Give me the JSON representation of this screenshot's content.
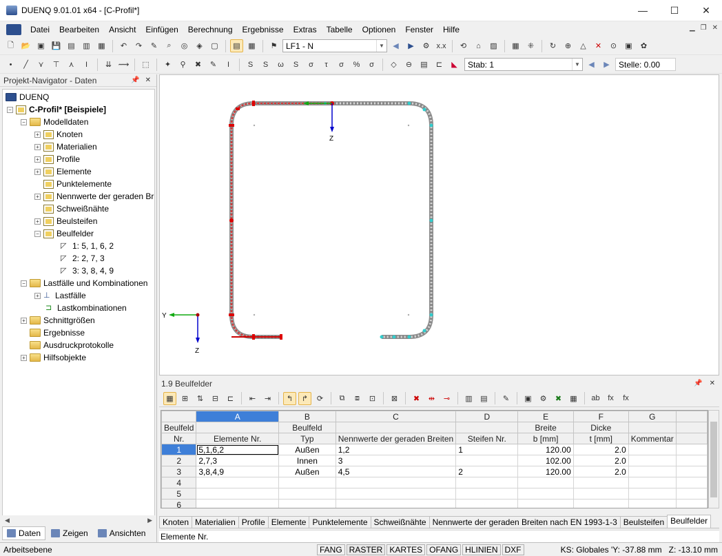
{
  "window": {
    "title": "DUENQ 9.01.01 x64 - [C-Profil*]",
    "min": "—",
    "max": "☐",
    "close": "✕"
  },
  "menu": [
    "Datei",
    "Bearbeiten",
    "Ansicht",
    "Einfügen",
    "Berechnung",
    "Ergebnisse",
    "Extras",
    "Tabelle",
    "Optionen",
    "Fenster",
    "Hilfe"
  ],
  "toolbar": {
    "loadcase": "LF1 - N",
    "stab_label": "Stab: 1",
    "stelle_label": "Stelle: 0.00"
  },
  "navigator": {
    "title": "Projekt-Navigator - Daten",
    "root": "DUENQ",
    "project": "C-Profil* [Beispiele]",
    "items": [
      "Modelldaten",
      "Knoten",
      "Materialien",
      "Profile",
      "Elemente",
      "Punktelemente",
      "Nennwerte der geraden Br",
      "Schweißnähte",
      "Beulsteifen",
      "Beulfelder",
      "1: 5, 1, 6, 2",
      "2: 2, 7, 3",
      "3: 3, 8, 4, 9",
      "Lastfälle und Kombinationen",
      "Lastfälle",
      "Lastkombinationen",
      "Schnittgrößen",
      "Ergebnisse",
      "Ausdruckprotokolle",
      "Hilfsobjekte"
    ],
    "tabs": [
      "Daten",
      "Zeigen",
      "Ansichten"
    ]
  },
  "canvas": {
    "axis_y": "Y",
    "axis_z": "Z"
  },
  "table": {
    "title": "1.9 Beulfelder",
    "columns": [
      "A",
      "B",
      "C",
      "D",
      "E",
      "F",
      "G"
    ],
    "headers": {
      "rownum": [
        "Beulfeld",
        "Nr."
      ],
      "A": [
        "",
        "Elemente Nr."
      ],
      "B": [
        "Beulfeld",
        "Typ"
      ],
      "C": [
        "",
        "Nennwerte der geraden Breiten"
      ],
      "D": [
        "",
        "Steifen Nr."
      ],
      "E": [
        "Breite",
        "b [mm]"
      ],
      "F": [
        "Dicke",
        "t [mm]"
      ],
      "G": [
        "",
        "Kommentar"
      ]
    },
    "rows": [
      {
        "nr": "1",
        "A": "5,1,6,2",
        "B": "Außen",
        "C": "1,2",
        "D": "1",
        "E": "120.00",
        "F": "2.0",
        "G": ""
      },
      {
        "nr": "2",
        "A": "2,7,3",
        "B": "Innen",
        "C": "3",
        "D": "",
        "E": "102.00",
        "F": "2.0",
        "G": ""
      },
      {
        "nr": "3",
        "A": "3,8,4,9",
        "B": "Außen",
        "C": "4,5",
        "D": "2",
        "E": "120.00",
        "F": "2.0",
        "G": ""
      },
      {
        "nr": "4",
        "A": "",
        "B": "",
        "C": "",
        "D": "",
        "E": "",
        "F": "",
        "G": ""
      },
      {
        "nr": "5",
        "A": "",
        "B": "",
        "C": "",
        "D": "",
        "E": "",
        "F": "",
        "G": ""
      },
      {
        "nr": "6",
        "A": "",
        "B": "",
        "C": "",
        "D": "",
        "E": "",
        "F": "",
        "G": ""
      }
    ],
    "tabs": [
      "Knoten",
      "Materialien",
      "Profile",
      "Elemente",
      "Punktelemente",
      "Schweißnähte",
      "Nennwerte der geraden Breiten nach EN 1993-1-3",
      "Beulsteifen",
      "Beulfelder"
    ],
    "status": "Elemente Nr."
  },
  "statusbar": {
    "workplane": "Arbeitsebene",
    "buttons": [
      "FANG",
      "RASTER",
      "KARTES",
      "OFANG",
      "HLINIEN",
      "DXF"
    ],
    "ks": "KS: Globales 'Y: -37.88 mm",
    "z": "Z: -13.10 mm"
  }
}
